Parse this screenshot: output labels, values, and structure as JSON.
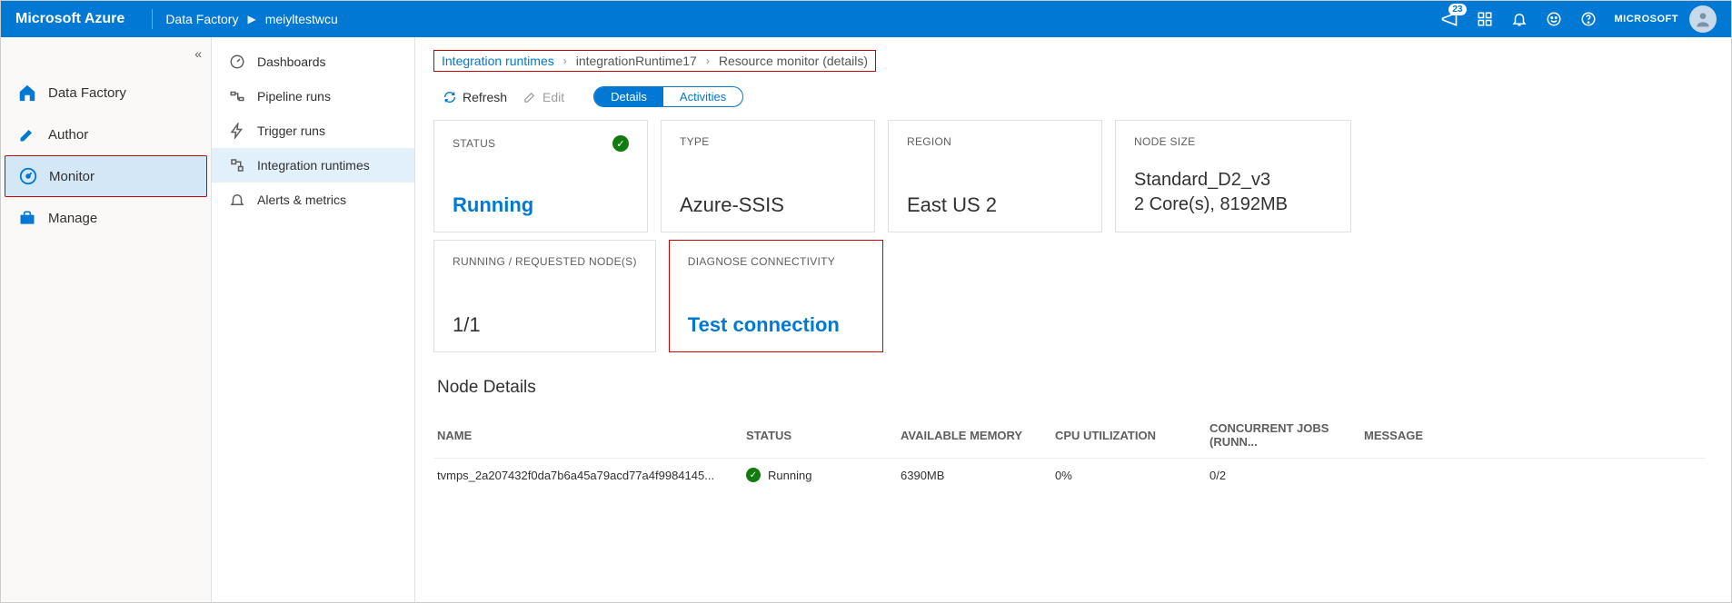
{
  "topbar": {
    "logo": "Microsoft Azure",
    "service": "Data Factory",
    "resource": "meiyltestwcu",
    "notification_count": "23",
    "org": "MICROSOFT"
  },
  "nav1": {
    "collapse_glyph": "«",
    "items": [
      {
        "label": "Data Factory",
        "icon": "home"
      },
      {
        "label": "Author",
        "icon": "pencil"
      },
      {
        "label": "Monitor",
        "icon": "gauge",
        "active": true
      },
      {
        "label": "Manage",
        "icon": "toolbox"
      }
    ]
  },
  "nav2": {
    "items": [
      {
        "label": "Dashboards",
        "icon": "gauge"
      },
      {
        "label": "Pipeline runs",
        "icon": "pipeline"
      },
      {
        "label": "Trigger runs",
        "icon": "trigger"
      },
      {
        "label": "Integration runtimes",
        "icon": "integration",
        "active": true
      },
      {
        "label": "Alerts & metrics",
        "icon": "bell"
      }
    ]
  },
  "breadcrumb": {
    "link": "Integration runtimes",
    "mid": "integrationRuntime17",
    "curr": "Resource monitor (details)"
  },
  "toolbar": {
    "refresh": "Refresh",
    "edit": "Edit",
    "pill_details": "Details",
    "pill_activities": "Activities"
  },
  "cards": {
    "status": {
      "label": "STATUS",
      "value": "Running"
    },
    "type": {
      "label": "TYPE",
      "value": "Azure-SSIS"
    },
    "region": {
      "label": "REGION",
      "value": "East US 2"
    },
    "nodesize": {
      "label": "NODE SIZE",
      "value1": "Standard_D2_v3",
      "value2": "2 Core(s), 8192MB"
    },
    "nodes": {
      "label": "RUNNING / REQUESTED NODE(S)",
      "value": "1/1"
    },
    "diagnose": {
      "label": "DIAGNOSE CONNECTIVITY",
      "value": "Test connection"
    }
  },
  "nodeDetails": {
    "title": "Node Details",
    "headers": {
      "name": "NAME",
      "status": "STATUS",
      "memory": "AVAILABLE MEMORY",
      "cpu": "CPU UTILIZATION",
      "jobs": "CONCURRENT JOBS (RUNN...",
      "message": "MESSAGE"
    },
    "rows": [
      {
        "name": "tvmps_2a207432f0da7b6a45a79acd77a4f9984145...",
        "status": "Running",
        "memory": "6390MB",
        "cpu": "0%",
        "jobs": "0/2",
        "message": ""
      }
    ]
  }
}
